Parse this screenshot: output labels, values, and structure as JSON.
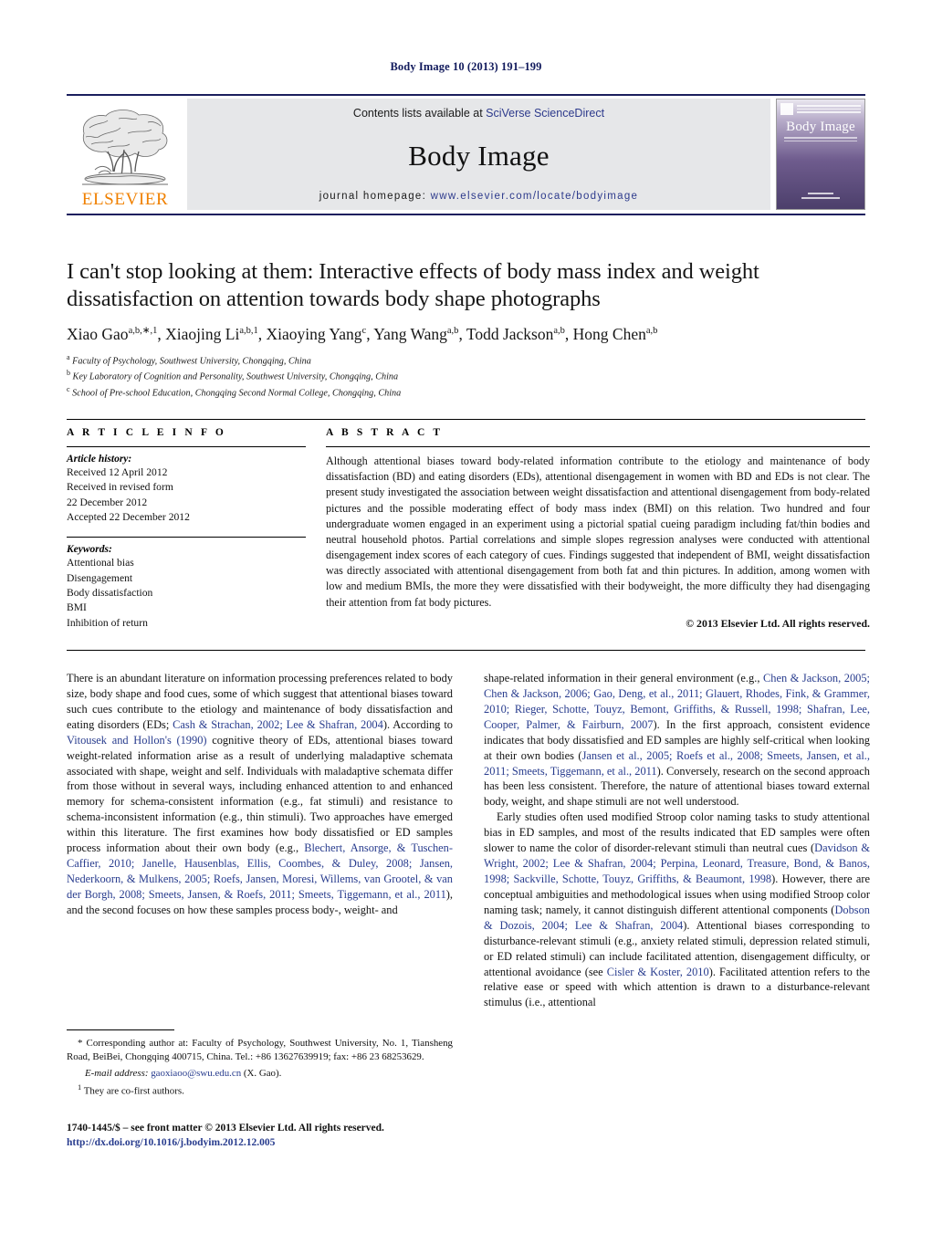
{
  "running_head": "Body Image 10 (2013) 191–199",
  "masthead": {
    "contents_prefix": "Contents lists available at ",
    "sciencedirect": "SciVerse ScienceDirect",
    "journal_title": "Body Image",
    "homepage_label": "journal homepage:",
    "homepage_url": "www.elsevier.com/locate/bodyimage",
    "publisher_logo_text": "ELSEVIER",
    "cover_title": "Body Image",
    "rule_color": "#1b1f5e",
    "banner_bg": "#e6e7e9",
    "logo_color": "#f08000",
    "link_color": "#2d3a8c"
  },
  "article": {
    "title": "I can't stop looking at them: Interactive effects of body mass index and weight dissatisfaction on attention towards body shape photographs",
    "authors_html": "Xiao Gao<sup>a,b,∗,1</sup>, Xiaojing Li<sup>a,b,1</sup>, Xiaoying Yang<sup>c</sup>, Yang Wang<sup>a,b</sup>, Todd Jackson<sup>a,b</sup>, Hong Chen<sup>a,b</sup>",
    "affiliations": [
      {
        "marker": "a",
        "text": "Faculty of Psychology, Southwest University, Chongqing, China"
      },
      {
        "marker": "b",
        "text": "Key Laboratory of Cognition and Personality, Southwest University, Chongqing, China"
      },
      {
        "marker": "c",
        "text": "School of Pre-school Education, Chongqing Second Normal College, Chongqing, China"
      }
    ]
  },
  "article_info": {
    "heading": "A R T I C L E   I N F O",
    "history_label": "Article history:",
    "history": [
      "Received 12 April 2012",
      "Received in revised form",
      "22 December 2012",
      "Accepted 22 December 2012"
    ],
    "keywords_label": "Keywords:",
    "keywords": [
      "Attentional bias",
      "Disengagement",
      "Body dissatisfaction",
      "BMI",
      "Inhibition of return"
    ]
  },
  "abstract": {
    "heading": "A B S T R A C T",
    "text": "Although attentional biases toward body-related information contribute to the etiology and maintenance of body dissatisfaction (BD) and eating disorders (EDs), attentional disengagement in women with BD and EDs is not clear. The present study investigated the association between weight dissatisfaction and attentional disengagement from body-related pictures and the possible moderating effect of body mass index (BMI) on this relation. Two hundred and four undergraduate women engaged in an experiment using a pictorial spatial cueing paradigm including fat/thin bodies and neutral household photos. Partial correlations and simple slopes regression analyses were conducted with attentional disengagement index scores of each category of cues. Findings suggested that independent of BMI, weight dissatisfaction was directly associated with attentional disengagement from both fat and thin pictures. In addition, among women with low and medium BMIs, the more they were dissatisfied with their bodyweight, the more difficulty they had disengaging their attention from fat body pictures.",
    "copyright": "© 2013 Elsevier Ltd. All rights reserved."
  },
  "body": {
    "left_paragraphs": [
      "There is an abundant literature on information processing preferences related to body size, body shape and food cues, some of which suggest that attentional biases toward such cues contribute to the etiology and maintenance of body dissatisfaction and eating disorders (EDs; <span class=\"cite\">Cash &amp; Strachan, 2002; Lee &amp; Shafran, 2004</span>). According to <span class=\"cite\">Vitousek and Hollon's (1990)</span> cognitive theory of EDs, attentional biases toward weight-related information arise as a result of underlying maladaptive schemata associated with shape, weight and self. Individuals with maladaptive schemata differ from those without in several ways, including enhanced attention to and enhanced memory for schema-consistent information (e.g., fat stimuli) and resistance to schema-inconsistent information (e.g., thin stimuli). Two approaches have emerged within this literature. The first examines how body dissatisfied or ED samples process information about their own body (e.g., <span class=\"cite\">Blechert, Ansorge, &amp; Tuschen-Caffier, 2010; Janelle, Hausenblas, Ellis, Coombes, &amp; Duley, 2008; Jansen, Nederkoorn, &amp; Mulkens, 2005; Roefs, Jansen, Moresi, Willems, van Grootel, &amp; van der Borgh, 2008; Smeets, Jansen, &amp; Roefs, 2011; Smeets, Tiggemann, et al., 2011</span>), and the second focuses on how these samples process body-, weight- and"
    ],
    "right_paragraphs": [
      "shape-related information in their general environment (e.g., <span class=\"cite\">Chen &amp; Jackson, 2005; Chen &amp; Jackson, 2006; Gao, Deng, et al., 2011; Glauert, Rhodes, Fink, &amp; Grammer, 2010; Rieger, Schotte, Touyz, Bemont, Griffiths, &amp; Russell, 1998; Shafran, Lee, Cooper, Palmer, &amp; Fairburn, 2007</span>). In the first approach, consistent evidence indicates that body dissatisfied and ED samples are highly self-critical when looking at their own bodies (<span class=\"cite\">Jansen et al., 2005; Roefs et al., 2008; Smeets, Jansen, et al., 2011; Smeets, Tiggemann, et al., 2011</span>). Conversely, research on the second approach has been less consistent. Therefore, the nature of attentional biases toward external body, weight, and shape stimuli are not well understood.",
      "Early studies often used modified Stroop color naming tasks to study attentional bias in ED samples, and most of the results indicated that ED samples were often slower to name the color of disorder-relevant stimuli than neutral cues (<span class=\"cite\">Davidson &amp; Wright, 2002; Lee &amp; Shafran, 2004; Perpina, Leonard, Treasure, Bond, &amp; Banos, 1998; Sackville, Schotte, Touyz, Griffiths, &amp; Beaumont, 1998</span>). However, there are conceptual ambiguities and methodological issues when using modified Stroop color naming task; namely, it cannot distinguish different attentional components (<span class=\"cite\">Dobson &amp; Dozois, 2004; Lee &amp; Shafran, 2004</span>). Attentional biases corresponding to disturbance-relevant stimuli (e.g., anxiety related stimuli, depression related stimuli, or ED related stimuli) can include facilitated attention, disengagement difficulty, or attentional avoidance (see <span class=\"cite\">Cisler &amp; Koster, 2010</span>). Facilitated attention refers to the relative ease or speed with which attention is drawn to a disturbance-relevant stimulus (i.e., attentional"
    ],
    "cite_color": "#283c8e"
  },
  "footnote": {
    "corresponding": "* Corresponding author at: Faculty of Psychology, Southwest University, No. 1, Tiansheng Road, BeiBei, Chongqing 400715, China. Tel.: +86 13627639919; fax: +86 23 68253629.",
    "email_label": "E-mail address:",
    "email": "gaoxiaoo@swu.edu.cn",
    "email_suffix": "(X. Gao).",
    "cofirst_marker": "1",
    "cofirst": "They are co-first authors."
  },
  "bottom": {
    "issn": "1740-1445/$ – see front matter © 2013 Elsevier Ltd. All rights reserved.",
    "doi": "http://dx.doi.org/10.1016/j.bodyim.2012.12.005"
  }
}
